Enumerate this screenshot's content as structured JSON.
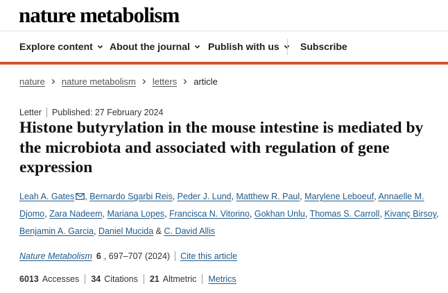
{
  "site": {
    "logo": "nature metabolism"
  },
  "nav": {
    "items": [
      {
        "label": "Explore content",
        "has_dropdown": true
      },
      {
        "label": "About the journal",
        "has_dropdown": true
      },
      {
        "label": "Publish with us",
        "has_dropdown": true
      },
      {
        "label": "Subscribe",
        "has_dropdown": false
      }
    ],
    "accent_color": "#d0542c"
  },
  "breadcrumb": [
    "nature",
    "nature metabolism",
    "letters",
    "article"
  ],
  "article": {
    "type": "Letter",
    "published": "Published: 27 February 2024",
    "title": "Histone butyrylation in the mouse intestine is mediated by the microbiota and associated with regulation of gene expression",
    "authors": [
      "Leah A. Gates",
      "Bernardo Sgarbi Reis",
      "Peder J. Lund",
      "Matthew R. Paul",
      "Marylene Leboeuf",
      "Annaelle M. Djomo",
      "Zara Nadeem",
      "Mariana Lopes",
      "Francisca N. Vitorino",
      "Gokhan Unlu",
      "Thomas S. Carroll",
      "Kivanç Birsoy",
      "Benjamin A. Garcia",
      "Daniel Mucida",
      "C. David Allis"
    ],
    "author_separator": ", ",
    "last_separator": " & ",
    "citation": {
      "journal": "Nature Metabolism",
      "volume": "6",
      "pages": ", 697–707 (2024)",
      "cite_label": "Cite this article"
    },
    "metrics": {
      "accesses_value": "6013",
      "accesses_label": "Accesses",
      "citations_value": "34",
      "citations_label": "Citations",
      "altmetric_value": "21",
      "altmetric_label": "Altmetric",
      "metrics_link": "Metrics"
    }
  },
  "icons": {
    "dropdown": "chevron-down-icon",
    "breadcrumb_sep": "chevron-right-icon",
    "contact": "mail-icon"
  }
}
